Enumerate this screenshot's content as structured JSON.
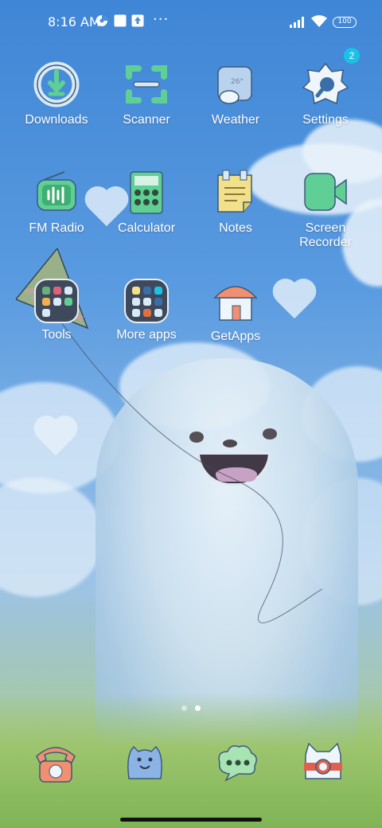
{
  "status_bar": {
    "time": "8:16 AM",
    "more": "···",
    "battery": "100"
  },
  "apps": [
    {
      "label": "Downloads"
    },
    {
      "label": "Scanner"
    },
    {
      "label": "Weather"
    },
    {
      "label": "Settings",
      "badge": "2"
    },
    {
      "label": "FM Radio"
    },
    {
      "label": "Calculator"
    },
    {
      "label": "Notes"
    },
    {
      "label": "Screen\nRecorder"
    },
    {
      "label": "Tools"
    },
    {
      "label": "More apps"
    },
    {
      "label": "GetApps"
    }
  ],
  "weather_icon_text": "26°",
  "pager": {
    "active_page": 2,
    "page_count": 2
  },
  "dock": [
    {
      "icon": "phone-icon"
    },
    {
      "icon": "contacts-icon"
    },
    {
      "icon": "messages-icon"
    },
    {
      "icon": "camera-icon"
    }
  ],
  "colors": {
    "badge": "#19c2e6",
    "accent_green": "#5fcf95"
  }
}
